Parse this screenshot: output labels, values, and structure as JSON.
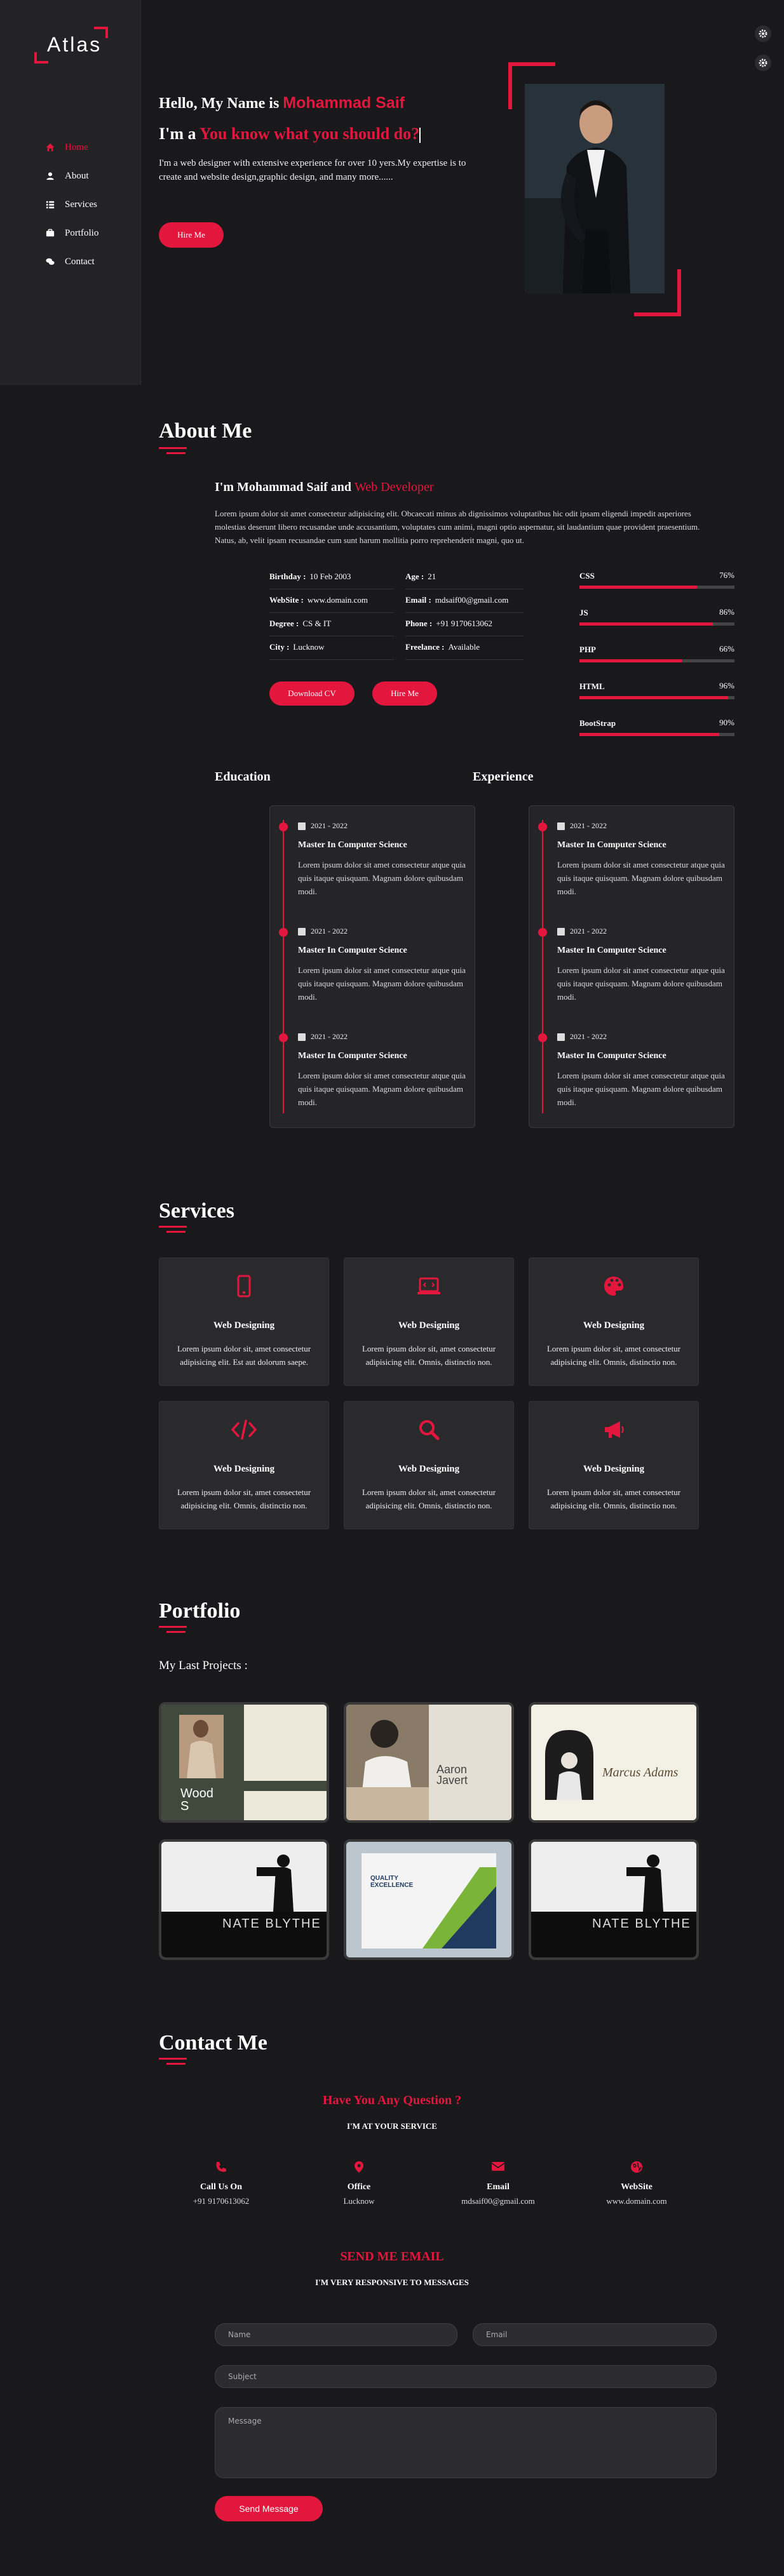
{
  "brand": {
    "logo_text": "Atlas"
  },
  "nav": [
    {
      "label": "Home",
      "icon": "home-icon"
    },
    {
      "label": "About",
      "icon": "user-icon"
    },
    {
      "label": "Services",
      "icon": "list-icon"
    },
    {
      "label": "Portfolio",
      "icon": "briefcase-icon"
    },
    {
      "label": "Contact",
      "icon": "chat-icon"
    }
  ],
  "hero": {
    "hello": "Hello, My Name is",
    "name": "Mohammad Saif",
    "role_prefix": "I'm a",
    "role_highlight": "You know what you should do?",
    "description": "I'm a web designer with extensive experience for over 10 yers.My expertise is to create and website design,graphic design, and many more......",
    "hire_button": "Hire Me"
  },
  "about": {
    "title": "About Me",
    "heading_prefix": "I'm Mohammad Saif and",
    "heading_highlight": "Web Developer",
    "text": "Lorem ipsum dolor sit amet consectetur adipisicing elit. Obcaecati minus ab dignissimos voluptatibus hic odit ipsam eligendi impedit asperiores molestias deserunt libero recusandae unde accusantium, voluptates cum animi, magni optio aspernatur, sit laudantium quae provident praesentium. Natus, ab, velit ipsam recusandae cum sunt harum mollitia porro reprehenderit magni, quo ut.",
    "info": [
      {
        "label": "Birthday :",
        "value": "10 Feb 2003"
      },
      {
        "label": "Age :",
        "value": "21"
      },
      {
        "label": "WebSite :",
        "value": "www.domain.com"
      },
      {
        "label": "Email :",
        "value": "mdsaif00@gmail.com"
      },
      {
        "label": "Degree :",
        "value": "CS & IT"
      },
      {
        "label": "Phone :",
        "value": "+91 9170613062"
      },
      {
        "label": "City :",
        "value": "Lucknow"
      },
      {
        "label": "Freelance :",
        "value": "Available"
      }
    ],
    "download_button": "Download CV",
    "hire_button": "Hire Me",
    "skills": [
      {
        "name": "CSS",
        "percent_label": "76%",
        "value": 76
      },
      {
        "name": "JS",
        "percent_label": "86%",
        "value": 86
      },
      {
        "name": "PHP",
        "percent_label": "66%",
        "value": 66
      },
      {
        "name": "HTML",
        "percent_label": "96%",
        "value": 96
      },
      {
        "name": "BootStrap",
        "percent_label": "90%",
        "value": 90
      }
    ],
    "education_title": "Education",
    "experience_title": "Experience",
    "education": [
      {
        "date": "2021 - 2022",
        "title": "Master In Computer Science",
        "text": "Lorem ipsum dolor sit amet consectetur atque quia quis itaque quisquam. Magnam dolore quibusdam modi."
      },
      {
        "date": "2021 - 2022",
        "title": "Master In Computer Science",
        "text": "Lorem ipsum dolor sit amet consectetur atque quia quis itaque quisquam. Magnam dolore quibusdam modi."
      },
      {
        "date": "2021 - 2022",
        "title": "Master In Computer Science",
        "text": "Lorem ipsum dolor sit amet consectetur atque quia quis itaque quisquam. Magnam dolore quibusdam modi."
      }
    ],
    "experience": [
      {
        "date": "2021 - 2022",
        "title": "Master In Computer Science",
        "text": "Lorem ipsum dolor sit amet consectetur atque quia quis itaque quisquam. Magnam dolore quibusdam modi."
      },
      {
        "date": "2021 - 2022",
        "title": "Master In Computer Science",
        "text": "Lorem ipsum dolor sit amet consectetur atque quia quis itaque quisquam. Magnam dolore quibusdam modi."
      },
      {
        "date": "2021 - 2022",
        "title": "Master In Computer Science",
        "text": "Lorem ipsum dolor sit amet consectetur atque quia quis itaque quisquam. Magnam dolore quibusdam modi."
      }
    ]
  },
  "services": {
    "title": "Services",
    "items": [
      {
        "icon": "mobile-icon",
        "title": "Web Designing",
        "text": "Lorem ipsum dolor sit, amet consectetur adipisicing elit. Est aut dolorum saepe."
      },
      {
        "icon": "laptop-code-icon",
        "title": "Web Designing",
        "text": "Lorem ipsum dolor sit, amet consectetur adipisicing elit. Omnis, distinctio non."
      },
      {
        "icon": "palette-icon",
        "title": "Web Designing",
        "text": "Lorem ipsum dolor sit, amet consectetur adipisicing elit. Omnis, distinctio non."
      },
      {
        "icon": "code-icon",
        "title": "Web Designing",
        "text": "Lorem ipsum dolor sit, amet consectetur adipisicing elit. Omnis, distinctio non."
      },
      {
        "icon": "search-icon",
        "title": "Web Designing",
        "text": "Lorem ipsum dolor sit, amet consectetur adipisicing elit. Omnis, distinctio non."
      },
      {
        "icon": "megaphone-icon",
        "title": "Web Designing",
        "text": "Lorem ipsum dolor sit, amet consectetur adipisicing elit. Omnis, distinctio non."
      }
    ]
  },
  "portfolio": {
    "title": "Portfolio",
    "subtitle": "My Last Projects :",
    "projects": [
      {
        "caption": "Wood S"
      },
      {
        "caption": "Aaron Javert"
      },
      {
        "caption": "Marcus Adams"
      },
      {
        "caption": "NATE BLYTHE"
      },
      {
        "caption": "QUALITY EXCELLENCE"
      },
      {
        "caption": "NATE BLYTHE"
      }
    ]
  },
  "contact": {
    "title": "Contact Me",
    "question": "Have You Any Question ?",
    "service_line": "I'M AT YOUR SERVICE",
    "items": [
      {
        "icon": "phone-icon",
        "title": "Call Us On",
        "value": "+91 9170613062"
      },
      {
        "icon": "map-pin-icon",
        "title": "Office",
        "value": "Lucknow"
      },
      {
        "icon": "envelope-icon",
        "title": "Email",
        "value": "mdsaif00@gmail.com"
      },
      {
        "icon": "globe-icon",
        "title": "WebSite",
        "value": "www.domain.com"
      }
    ],
    "send_title": "SEND ME EMAIL",
    "send_sub": "I'M VERY RESPONSIVE TO MESSAGES",
    "form": {
      "name_placeholder": "Name",
      "email_placeholder": "Email",
      "subject_placeholder": "Subject",
      "message_placeholder": "Message",
      "send_button": "Send Message"
    }
  },
  "colors": {
    "accent": "#e3173e",
    "background": "#19191b",
    "sidebar": "#232325",
    "card": "#2a2a2c"
  }
}
